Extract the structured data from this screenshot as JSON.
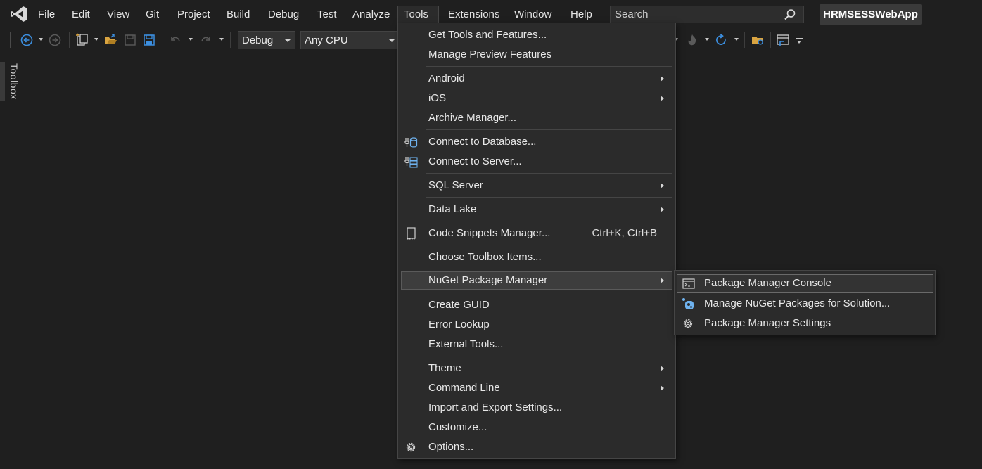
{
  "menubar": {
    "items": [
      "File",
      "Edit",
      "View",
      "Git",
      "Project",
      "Build",
      "Debug",
      "Test",
      "Analyze",
      "Tools",
      "Extensions",
      "Window",
      "Help"
    ],
    "search_placeholder": "Search",
    "solution_name": "HRMSESSWebApp"
  },
  "toolbar": {
    "configuration": "Debug",
    "platform": "Any CPU"
  },
  "toolbox": {
    "label": "Toolbox"
  },
  "tools_menu": {
    "items": [
      {
        "label": "Get Tools and Features...",
        "icon": ""
      },
      {
        "label": "Manage Preview Features",
        "icon": ""
      },
      {
        "label": "Android",
        "submenu": true
      },
      {
        "label": "iOS",
        "submenu": true
      },
      {
        "label": "Archive Manager..."
      },
      {
        "label": "Connect to Database...",
        "icon": "database-connect-icon"
      },
      {
        "label": "Connect to Server...",
        "icon": "server-connect-icon"
      },
      {
        "label": "SQL Server",
        "submenu": true
      },
      {
        "label": "Data Lake",
        "submenu": true
      },
      {
        "label": "Code Snippets Manager...",
        "shortcut": "Ctrl+K, Ctrl+B",
        "icon": "snippet-icon"
      },
      {
        "label": "Choose Toolbox Items..."
      },
      {
        "label": "NuGet Package Manager",
        "submenu": true,
        "highlighted": true
      },
      {
        "label": "Create GUID"
      },
      {
        "label": "Error Lookup"
      },
      {
        "label": "External Tools..."
      },
      {
        "label": "Theme",
        "submenu": true
      },
      {
        "label": "Command Line",
        "submenu": true
      },
      {
        "label": "Import and Export Settings..."
      },
      {
        "label": "Customize..."
      },
      {
        "label": "Options...",
        "icon": "gear-icon"
      }
    ]
  },
  "nuget_submenu": {
    "items": [
      {
        "label": "Package Manager Console",
        "icon": "console-icon",
        "highlighted": true
      },
      {
        "label": "Manage NuGet Packages for Solution...",
        "icon": "nuget-icon"
      },
      {
        "label": "Package Manager Settings",
        "icon": "gear-icon"
      }
    ]
  },
  "colors": {
    "background": "#1f1f1f",
    "menu_bg": "#2b2b2b",
    "accent_blue": "#3c8fe0",
    "folder_yellow": "#d9a441"
  }
}
